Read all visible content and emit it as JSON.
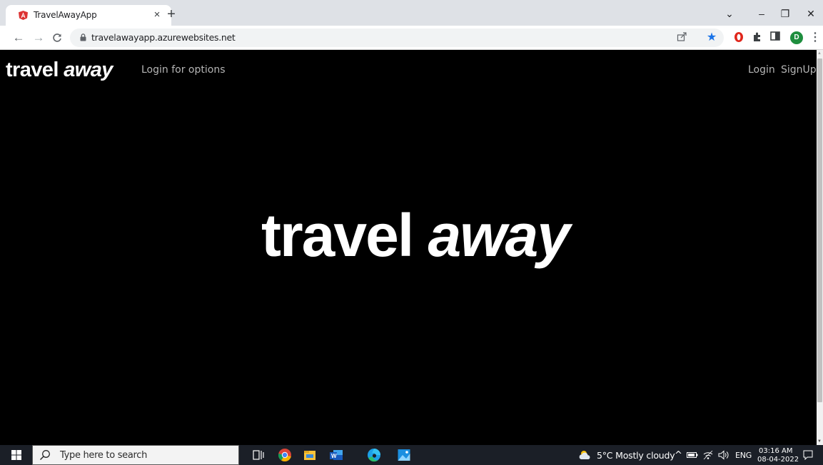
{
  "browser": {
    "tab_title": "TravelAwayApp",
    "tab_close": "×",
    "new_tab": "+",
    "url": "travelawayapp.azurewebsites.net",
    "avatar_letter": "D",
    "window_controls": {
      "dropdown": "⌄",
      "minimize": "–",
      "restore": "❐",
      "close": "✕"
    }
  },
  "page": {
    "brand": {
      "part1": "travel ",
      "part2": "away"
    },
    "nav_options": "Login for options",
    "login": "Login",
    "signup": "SignUp",
    "hero": {
      "part1": "travel ",
      "part2": "away"
    }
  },
  "taskbar": {
    "search_placeholder": "Type here to search",
    "weather": "5°C  Mostly cloudy",
    "language": "ENG",
    "time": "03:16 AM",
    "date": "08-04-2022"
  },
  "colors": {
    "accent_favicon": "#dd3333",
    "star": "#1a73e8",
    "opera": "#e0261b",
    "avatar": "#1e8e3e"
  },
  "icons": [
    "angular-icon",
    "back-icon",
    "forward-icon",
    "reload-icon",
    "lock-icon",
    "share-icon",
    "bookmark-star-icon",
    "opera-icon",
    "extensions-icon",
    "side-panel-icon",
    "profile-avatar",
    "menu-icon",
    "windows-start-icon",
    "search-icon",
    "task-view-icon",
    "chrome-icon",
    "file-explorer-icon",
    "word-icon",
    "edge-icon",
    "photos-icon",
    "weather-icon",
    "chevron-up-icon",
    "battery-icon",
    "wifi-icon",
    "volume-icon",
    "notification-icon"
  ]
}
